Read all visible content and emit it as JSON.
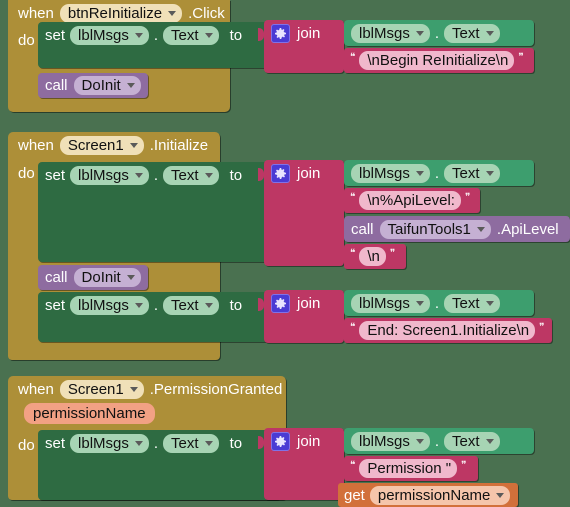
{
  "canvas": {
    "background": "#4a7150"
  },
  "colors": {
    "event_block": "#ad8f38",
    "setter_block": "#2e6b42",
    "text_block": "#bd3764",
    "procedure_block": "#8e6ca0",
    "variable_block": "#d2703a",
    "mutator_gear": "#4a3bd4"
  },
  "blocks": [
    {
      "id": "btn-reinitialize-click",
      "when_label": "when",
      "component": "btnReInitialize",
      "event": ".Click",
      "do_label": "do",
      "statements": [
        {
          "kind": "setter",
          "set_label": "set",
          "component": "lblMsgs",
          "dot": ".",
          "property": "Text",
          "to_label": "to",
          "value": {
            "kind": "join",
            "join_label": "join",
            "gear": "gear-icon",
            "args": [
              {
                "kind": "getter-prop",
                "component": "lblMsgs",
                "dot": ".",
                "property": "Text"
              },
              {
                "kind": "text",
                "value": "\\nBegin ReInitialize\\n"
              }
            ]
          }
        },
        {
          "kind": "call",
          "call_label": "call",
          "procedure": "DoInit"
        }
      ]
    },
    {
      "id": "screen1-initialize",
      "when_label": "when",
      "component": "Screen1",
      "event": ".Initialize",
      "do_label": "do",
      "statements": [
        {
          "kind": "setter",
          "set_label": "set",
          "component": "lblMsgs",
          "dot": ".",
          "property": "Text",
          "to_label": "to",
          "value": {
            "kind": "join",
            "join_label": "join",
            "gear": "gear-icon",
            "args": [
              {
                "kind": "getter-prop",
                "component": "lblMsgs",
                "dot": ".",
                "property": "Text"
              },
              {
                "kind": "text",
                "value": "\\n%ApiLevel: "
              },
              {
                "kind": "call-return",
                "call_label": "call",
                "component": "TaifunTools1",
                "method": ".ApiLevel"
              },
              {
                "kind": "text",
                "value": "\\n"
              }
            ]
          }
        },
        {
          "kind": "call",
          "call_label": "call",
          "procedure": "DoInit"
        },
        {
          "kind": "setter",
          "set_label": "set",
          "component": "lblMsgs",
          "dot": ".",
          "property": "Text",
          "to_label": "to",
          "value": {
            "kind": "join",
            "join_label": "join",
            "gear": "gear-icon",
            "args": [
              {
                "kind": "getter-prop",
                "component": "lblMsgs",
                "dot": ".",
                "property": "Text"
              },
              {
                "kind": "text",
                "value": "End: Screen1.Initialize\\n"
              }
            ]
          }
        }
      ]
    },
    {
      "id": "screen1-permissiongranted",
      "when_label": "when",
      "component": "Screen1",
      "event": ".PermissionGranted",
      "parameter": "permissionName",
      "do_label": "do",
      "statements": [
        {
          "kind": "setter",
          "set_label": "set",
          "component": "lblMsgs",
          "dot": ".",
          "property": "Text",
          "to_label": "to",
          "value": {
            "kind": "join",
            "join_label": "join",
            "gear": "gear-icon",
            "args": [
              {
                "kind": "getter-prop",
                "component": "lblMsgs",
                "dot": ".",
                "property": "Text"
              },
              {
                "kind": "text",
                "value": "Permission \""
              },
              {
                "kind": "get",
                "get_label": "get",
                "variable": "permissionName"
              }
            ]
          }
        }
      ]
    }
  ],
  "b1": {
    "when": "when",
    "component": "btnReInitialize",
    "event": ".Click",
    "do": "do",
    "set": "set",
    "target": "lblMsgs",
    "dot": ".",
    "prop": "Text",
    "to": "to",
    "join": "join",
    "arg1_comp": "lblMsgs",
    "arg1_dot": ".",
    "arg1_prop": "Text",
    "arg2_text": "\\nBegin ReInitialize\\n",
    "call": "call",
    "proc": "DoInit"
  },
  "b2": {
    "when": "when",
    "component": "Screen1",
    "event": ".Initialize",
    "do": "do",
    "set": "set",
    "target": "lblMsgs",
    "dot": ".",
    "prop": "Text",
    "to": "to",
    "join": "join",
    "arg1_comp": "lblMsgs",
    "arg1_dot": ".",
    "arg1_prop": "Text",
    "arg2_text": "\\n%ApiLevel: ",
    "arg3_call": "call",
    "arg3_comp": "TaifunTools1",
    "arg3_method": ".ApiLevel",
    "arg4_text": "\\n",
    "call": "call",
    "proc": "DoInit",
    "set2": "set",
    "target2": "lblMsgs",
    "dot2": ".",
    "prop2": "Text",
    "to2": "to",
    "join2": "join",
    "b_arg1_comp": "lblMsgs",
    "b_arg1_dot": ".",
    "b_arg1_prop": "Text",
    "b_arg2_text": "End: Screen1.Initialize\\n"
  },
  "b3": {
    "when": "when",
    "component": "Screen1",
    "event": ".PermissionGranted",
    "param": "permissionName",
    "do": "do",
    "set": "set",
    "target": "lblMsgs",
    "dot": ".",
    "prop": "Text",
    "to": "to",
    "join": "join",
    "arg1_comp": "lblMsgs",
    "arg1_dot": ".",
    "arg1_prop": "Text",
    "arg2_text": "Permission \"",
    "get": "get",
    "getvar": "permissionName"
  }
}
